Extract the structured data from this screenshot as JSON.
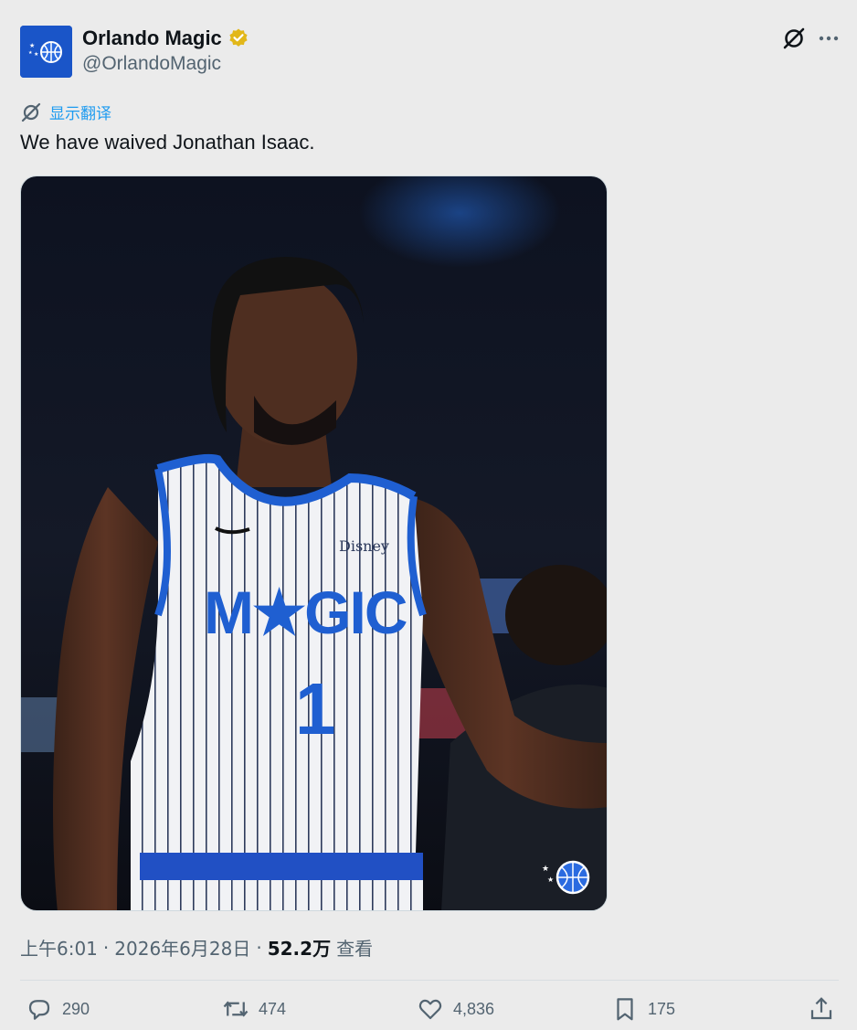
{
  "tweet": {
    "author": "Orlando Magic",
    "handle": "@OrlandoMagic",
    "translate_label": "显示翻译",
    "text": "We have waived Jonathan Isaac.",
    "time": "上午6:01",
    "date": "2026年6月28日",
    "views_count": "52.2万",
    "views_label": "查看",
    "separator": "·",
    "image_lettering": [
      "MAGIC",
      "1",
      "Disney"
    ]
  },
  "actions": {
    "replies": "290",
    "retweets": "474",
    "likes": "4,836",
    "bookmarks": "175"
  },
  "icons": [
    "grok-icon",
    "more-icon",
    "translate-icon",
    "verified-icon",
    "reply-icon",
    "retweet-icon",
    "like-icon",
    "bookmark-icon",
    "share-icon"
  ],
  "colors": {
    "link": "#1d9bf0",
    "verified": "#e2b719",
    "jersey_blue": "#1f5fd1",
    "magic_blue": "#1a55c8"
  }
}
